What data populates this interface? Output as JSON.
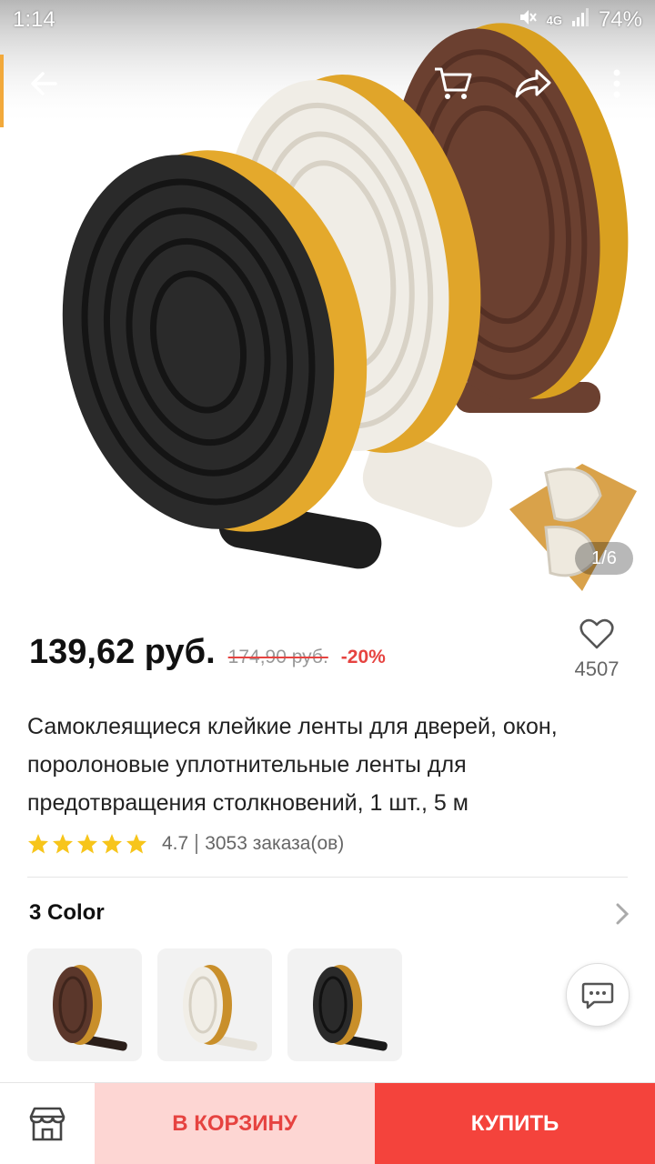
{
  "status_bar": {
    "time": "1:14",
    "network": "4G",
    "battery": "74%"
  },
  "top_bar": {
    "icons": [
      "back-arrow-icon",
      "cart-icon",
      "share-icon",
      "more-vert-icon"
    ]
  },
  "gallery": {
    "counter": "1/6",
    "rolls": [
      "black",
      "white",
      "brown"
    ]
  },
  "product": {
    "price": "139,62 руб.",
    "old_price": "174,90 руб.",
    "discount": "-20%",
    "wishlist_count": "4507",
    "title": "Самоклеящиеся клейкие ленты для дверей, окон, поролоновые уплотнительные ленты для предотвращения столкновений, 1 шт., 5 м",
    "rating": "4.7",
    "stars": 5,
    "orders": "3053 заказа(ов)"
  },
  "variants": {
    "title": "3 Color",
    "options": [
      "brown",
      "white",
      "black"
    ]
  },
  "bottom_bar": {
    "add_to_cart": "В КОРЗИНУ",
    "buy": "КУПИТЬ"
  },
  "colors": {
    "accent": "#f4433c",
    "cart_bg": "#fdd6d3",
    "star": "#f7c51b",
    "discount": "#e64340"
  }
}
